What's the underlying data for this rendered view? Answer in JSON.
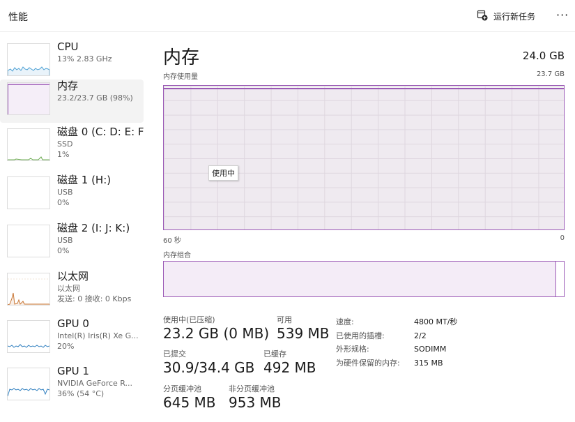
{
  "header": {
    "title": "性能",
    "run_task_label": "运行新任务",
    "more_label": "···"
  },
  "sidebar": {
    "items": [
      {
        "name": "CPU",
        "sub1": "13%  2.83 GHz",
        "sub2": "",
        "sub3": "",
        "graph_color": "#4a9fd4"
      },
      {
        "name": "内存",
        "sub1": "23.2/23.7 GB (98%)",
        "sub2": "",
        "sub3": "",
        "graph_color": "#9b59b6"
      },
      {
        "name": "磁盘 0 (C: D: E: F:",
        "sub1": "SSD",
        "sub2": "1%",
        "sub3": "",
        "graph_color": "#6aa84f"
      },
      {
        "name": "磁盘 1 (H:)",
        "sub1": "USB",
        "sub2": "0%",
        "sub3": "",
        "graph_color": "#6aa84f"
      },
      {
        "name": "磁盘 2 (I: J: K:)",
        "sub1": "USB",
        "sub2": "0%",
        "sub3": "",
        "graph_color": "#6aa84f"
      },
      {
        "name": "以太网",
        "sub1": "以太网",
        "sub2": "发送: 0  接收: 0 Kbps",
        "sub3": "",
        "graph_color": "#c87533"
      },
      {
        "name": "GPU 0",
        "sub1": "Intel(R) Iris(R) Xe G...",
        "sub2": "20%",
        "sub3": "",
        "graph_color": "#2f7fbf"
      },
      {
        "name": "GPU 1",
        "sub1": "NVIDIA GeForce R...",
        "sub2": "36%  (54 °C)",
        "sub3": "",
        "graph_color": "#2f7fbf"
      }
    ]
  },
  "main": {
    "title": "内存",
    "total": "24.0 GB",
    "usage_label": "内存使用量",
    "usage_max": "23.7 GB",
    "time_left": "60 秒",
    "time_right": "0",
    "tooltip": "使用中",
    "usage_fraction": 0.98,
    "composition_label": "内存组合",
    "composition_used_fraction": 0.98,
    "accent": "#9b59b6"
  },
  "stats": {
    "in_use_label": "使用中(已压缩)",
    "in_use_value": "23.2 GB (0 MB)",
    "available_label": "可用",
    "available_value": "539 MB",
    "committed_label": "已提交",
    "committed_value": "30.9/34.4 GB",
    "cached_label": "已缓存",
    "cached_value": "492 MB",
    "paged_label": "分页缓冲池",
    "paged_value": "645 MB",
    "nonpaged_label": "非分页缓冲池",
    "nonpaged_value": "953 MB"
  },
  "properties": [
    {
      "key": "速度:",
      "value": "4800 MT/秒"
    },
    {
      "key": "已使用的插槽:",
      "value": "2/2"
    },
    {
      "key": "外形规格:",
      "value": "SODIMM"
    },
    {
      "key": "为硬件保留的内存:",
      "value": "315 MB"
    }
  ]
}
